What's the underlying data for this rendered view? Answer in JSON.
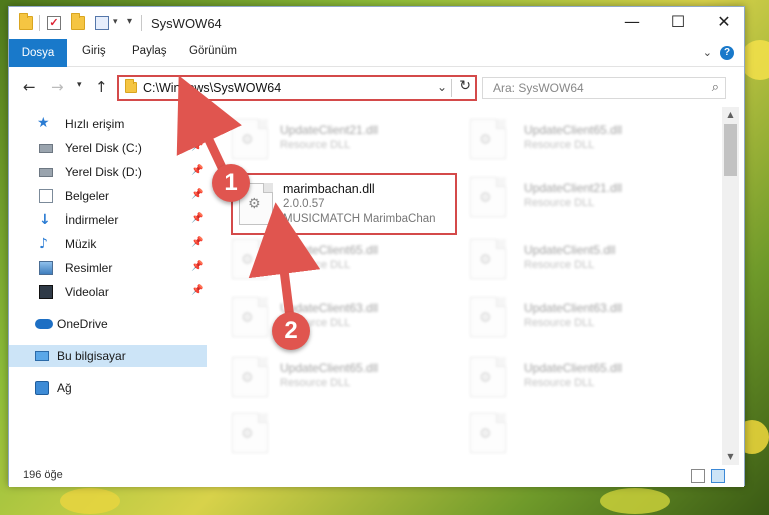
{
  "window": {
    "title": "SysWOW64",
    "minimize": "—",
    "maximize": "☐",
    "close": "✕"
  },
  "ribbon": {
    "tabs": [
      "Dosya",
      "Giriş",
      "Paylaş",
      "Görünüm"
    ],
    "help": "?"
  },
  "navbar": {
    "address": "C:\\Windows\\SysWOW64",
    "search_placeholder": "Ara: SysWOW64"
  },
  "sidebar": {
    "items": [
      {
        "label": "Hızlı erişim",
        "icon": "star-icon"
      },
      {
        "label": "Yerel Disk (C:)",
        "icon": "disk-icon",
        "pinned": true
      },
      {
        "label": "Yerel Disk (D:)",
        "icon": "disk-icon",
        "pinned": true
      },
      {
        "label": "Belgeler",
        "icon": "documents-icon",
        "pinned": true
      },
      {
        "label": "İndirmeler",
        "icon": "download-icon",
        "pinned": true
      },
      {
        "label": "Müzik",
        "icon": "music-icon",
        "pinned": true
      },
      {
        "label": "Resimler",
        "icon": "pictures-icon",
        "pinned": true
      },
      {
        "label": "Videolar",
        "icon": "videos-icon",
        "pinned": true
      },
      {
        "label": "OneDrive",
        "icon": "cloud-icon"
      },
      {
        "label": "Bu bilgisayar",
        "icon": "computer-icon",
        "selected": true
      },
      {
        "label": "Ağ",
        "icon": "network-icon"
      }
    ]
  },
  "files": {
    "highlighted": {
      "name": "marimbachan.dll",
      "version": "2.0.0.57",
      "description": "MUSICMATCH MarimbaChan"
    },
    "blurred": [
      {
        "name": "UpdateClient21.dll",
        "sub": "Resource DLL"
      },
      {
        "name": "UpdateClient65.dll",
        "sub": "Resource DLL"
      },
      {
        "name": "UpdateClient21.dll",
        "sub": "Resource DLL"
      },
      {
        "name": "UpdateClient65.dll",
        "sub": "Resource DLL"
      },
      {
        "name": "UpdateClient5.dll",
        "sub": "Resource DLL"
      },
      {
        "name": "UpdateClient63.dll",
        "sub": "Resource DLL"
      },
      {
        "name": "UpdateClient63.dll",
        "sub": "Resource DLL"
      },
      {
        "name": "UpdateClient65.dll",
        "sub": "Resource DLL"
      },
      {
        "name": "UpdateClient65.dll",
        "sub": "Resource DLL"
      }
    ]
  },
  "status": {
    "item_count": "196 öğe"
  },
  "annotations": {
    "step1": "1",
    "step2": "2",
    "color": "#e0554f"
  }
}
